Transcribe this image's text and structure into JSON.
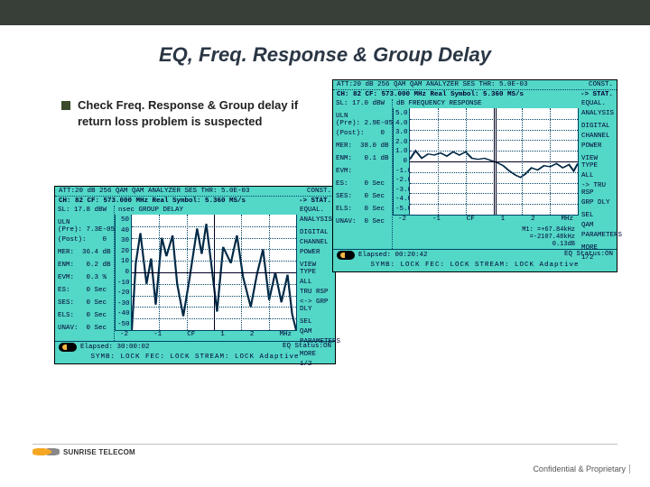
{
  "title": "EQ, Freq. Response & Group Delay",
  "bullet": "Check Freq. Response & Group delay if return loss problem is suspected",
  "footer_logo_text": "SUNRISE TELECOM",
  "confidential": "Confidential & Proprietary",
  "analyzer_left": {
    "header_left": "ATT:20 dB   256 QAM        QAM ANALYZER        SES THR: 5.0E-03",
    "header_right": "CONST.",
    "sub_left": "CH: 82 CF:  573.000 MHz  Real Symbol: 5.360 MS/s",
    "sub_right": "-> STAT.",
    "banner": "nsec GROUP DELAY",
    "right_labels": [
      "EQUAL.",
      "ANALYSIS",
      "",
      "DIGITAL",
      "CHANNEL",
      "POWER",
      "",
      "VIEW TYPE",
      "ALL",
      "TRU RSP",
      "<-> GRP DLY",
      "",
      "SEL",
      "QAM",
      "PARAMETERS",
      "",
      "MORE",
      "1/2"
    ],
    "left_labels": [
      "SL: 17.8 dBW",
      "",
      "ULN\n(Pre): 7.3E-05",
      "(Post):    0",
      "",
      "MER:  36.4 dB",
      "",
      "ENM:   0.2 dB",
      "",
      "EVM:   0.3 %",
      "",
      "ES:    0 Sec",
      "",
      "SES:   0 Sec",
      "",
      "ELS:   0 Sec",
      "",
      "UNAV:  0 Sec"
    ],
    "y_ticks": [
      "50",
      "40",
      "30",
      "20",
      "10",
      "0",
      "-10",
      "-20",
      "-30",
      "-40",
      "-50"
    ],
    "x_ticks": [
      "-2",
      "-1",
      "CF",
      "1",
      "2",
      "MHz"
    ],
    "footer1_left": "Elapsed: 30:00:02",
    "footer1_right": "EQ Status:ON",
    "footer2": "SYMB: LOCK   FEC: LOCK   STREAM: LOCK   Adaptive"
  },
  "analyzer_right": {
    "header_left": "ATT:20 dB   256 QAM        QAM ANALYZER        SES THR: 5.0E-03",
    "header_right": "CONST.",
    "sub_left": "CH: 82 CF:  573.000 MHz  Real Symbol: 5.360 MS/s",
    "sub_right": "-> STAT.",
    "banner": "dB FREQUENCY RESPONSE",
    "right_labels": [
      "EQUAL.",
      "ANALYSIS",
      "",
      "DIGITAL",
      "CHANNEL",
      "POWER",
      "",
      "VIEW TYPE",
      "ALL",
      "-> TRU RSP",
      "GRP DLY",
      "",
      "SEL",
      "QAM",
      "PARAMETERS",
      "",
      "MORE",
      "1/2"
    ],
    "left_labels": [
      "SL: 17.0 dBW",
      "",
      "ULN\n(Pre): 2.9E-05",
      "(Post):    0",
      "",
      "MER:  38.0 dB",
      "",
      "ENM:   0.1 dB",
      "",
      "EVM:",
      "",
      "ES:    0 Sec",
      "",
      "SES:   0 Sec",
      "",
      "ELS:   0 Sec",
      "",
      "UNAV:  0 Sec"
    ],
    "y_ticks": [
      "5.0",
      "4.0",
      "3.0",
      "2.0",
      "1.0",
      "0",
      "-1.0",
      "-2.0",
      "-3.0",
      "-4.0",
      "-5.0"
    ],
    "x_ticks": [
      "-2",
      "-1",
      "CF",
      "1",
      "2",
      "MHz"
    ],
    "marker_text": [
      "M1: =+67.84kHz",
      "   =-2107.48kHz",
      "   0.13dB"
    ],
    "footer1_left": "Elapsed: 00:20:42",
    "footer1_right": "EQ Status:ON",
    "footer2": "SYMB: LOCK   FEC: LOCK   STREAM: LOCK   Adaptive"
  },
  "chart_data": [
    {
      "type": "line",
      "title": "GROUP DELAY",
      "ylabel": "nsec",
      "xlabel": "MHz",
      "ylim": [
        -50,
        50
      ],
      "xlim": [
        -2.68,
        2.68
      ],
      "x": [
        -2.68,
        -2.55,
        -2.4,
        -2.2,
        -2.05,
        -1.9,
        -1.7,
        -1.55,
        -1.35,
        -1.2,
        -1.0,
        -0.8,
        -0.55,
        -0.4,
        -0.25,
        -0.1,
        0.1,
        0.3,
        0.55,
        0.75,
        0.95,
        1.2,
        1.4,
        1.6,
        1.8,
        2.0,
        2.2,
        2.4,
        2.55,
        2.68
      ],
      "values": [
        -50,
        8,
        34,
        -10,
        12,
        -28,
        30,
        14,
        32,
        -10,
        -38,
        -6,
        38,
        16,
        42,
        10,
        -34,
        22,
        8,
        32,
        -4,
        -30,
        -2,
        20,
        -24,
        0,
        -26,
        -2,
        -36,
        -50
      ]
    },
    {
      "type": "line",
      "title": "FREQUENCY RESPONSE",
      "ylabel": "dB",
      "xlabel": "MHz",
      "ylim": [
        -5,
        5
      ],
      "xlim": [
        -2.68,
        2.68
      ],
      "x": [
        -2.68,
        -2.5,
        -2.3,
        -2.1,
        -1.9,
        -1.7,
        -1.5,
        -1.3,
        -1.1,
        -0.9,
        -0.7,
        -0.5,
        -0.3,
        -0.1,
        0.1,
        0.3,
        0.5,
        0.7,
        0.85,
        1.0,
        1.2,
        1.4,
        1.6,
        1.8,
        2.0,
        2.2,
        2.4,
        2.55,
        2.68
      ],
      "values": [
        0.2,
        1.0,
        0.3,
        0.7,
        0.6,
        0.8,
        0.5,
        0.9,
        0.6,
        0.9,
        0.3,
        0.2,
        0.3,
        0.1,
        -0.1,
        -0.4,
        -0.9,
        -1.3,
        -1.5,
        -1.2,
        -0.6,
        -0.8,
        -0.4,
        -0.5,
        -0.2,
        -0.6,
        -0.3,
        -0.9,
        -0.2
      ]
    }
  ]
}
